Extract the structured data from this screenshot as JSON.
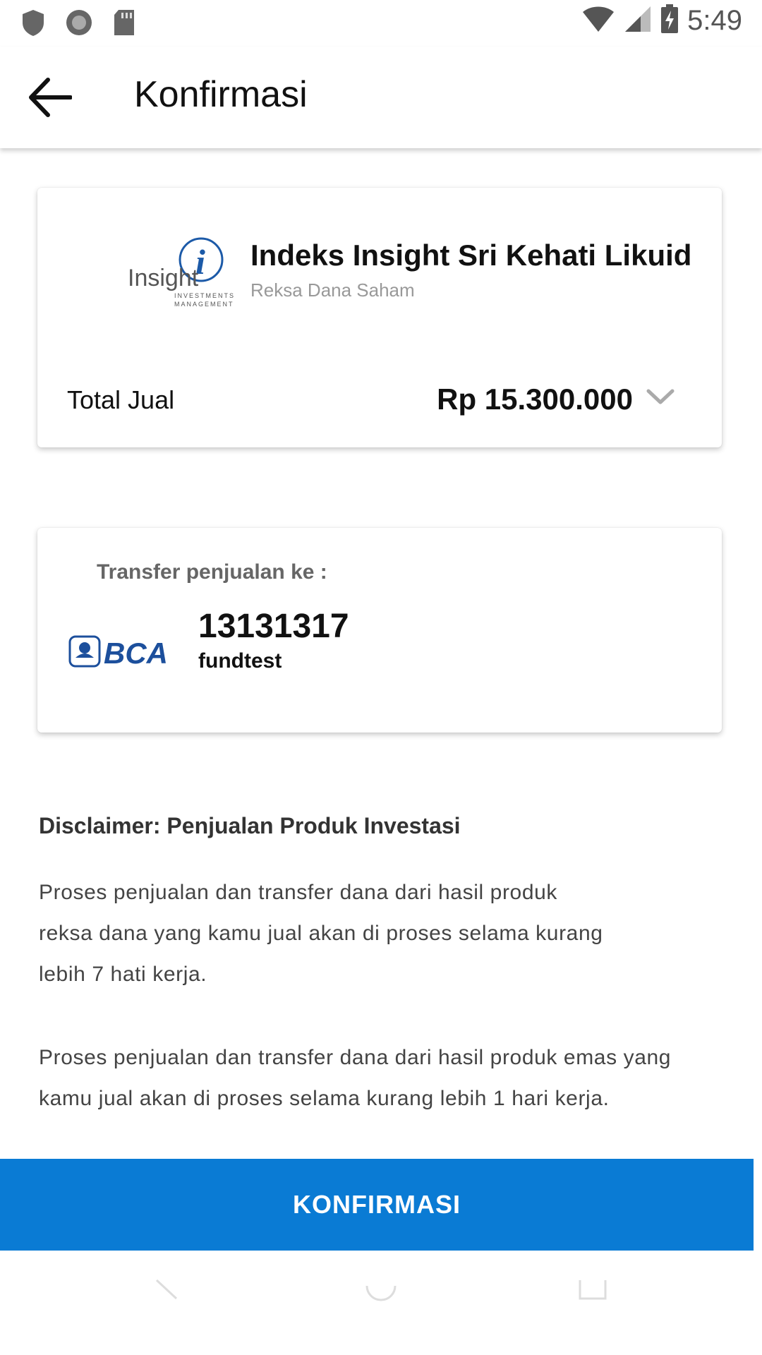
{
  "status_bar": {
    "time": "5:49",
    "left_icons": [
      "shield-icon",
      "record-icon",
      "sd-card-icon"
    ],
    "right_icons": [
      "wifi-icon",
      "signal-icon",
      "battery-charging-icon"
    ]
  },
  "app_bar": {
    "back_icon": "arrow-left-icon",
    "title": "Konfirmasi"
  },
  "fund_card": {
    "logo_text": "Insight",
    "logo_subtext_1": "INVESTMENTS",
    "logo_subtext_2": "MANAGEMENT",
    "fund_name": "Indeks Insight Sri Kehati Likuid",
    "fund_type": "Reksa Dana Saham",
    "total_label": "Total Jual",
    "total_value": "Rp 15.300.000",
    "expand_icon": "chevron-down-icon"
  },
  "transfer_card": {
    "title": "Transfer penjualan ke :",
    "bank_logo_text": "BCA",
    "account_number": "13131317",
    "account_name": "fundtest"
  },
  "disclaimer": {
    "title": "Disclaimer: Penjualan Produk Investasi",
    "paragraph_1": "Proses penjualan dan transfer dana dari hasil produk reksa dana yang kamu jual akan di proses selama kurang lebih 7 hati kerja.",
    "paragraph_2": "Proses penjualan dan transfer dana dari hasil produk emas yang kamu jual akan di proses selama kurang lebih 1 hari kerja."
  },
  "confirm_button": {
    "label": "KONFIRMASI",
    "color": "#0a7bd4"
  },
  "nav_bar": {
    "items": [
      "back-nav-icon",
      "home-nav-icon",
      "recents-nav-icon"
    ]
  }
}
